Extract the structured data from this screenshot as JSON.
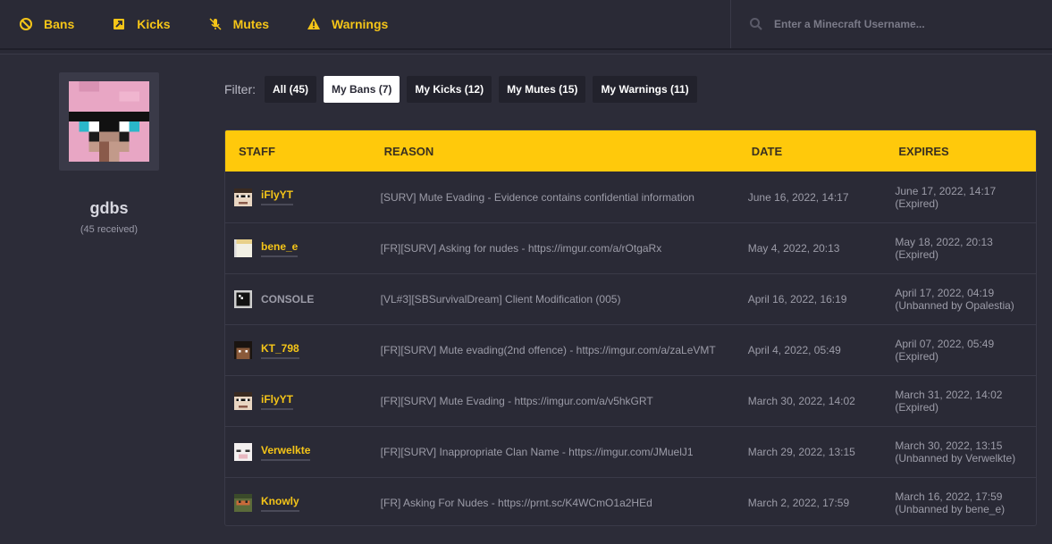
{
  "nav": {
    "bans": "Bans",
    "kicks": "Kicks",
    "mutes": "Mutes",
    "warnings": "Warnings",
    "search_placeholder": "Enter a Minecraft Username..."
  },
  "profile": {
    "username": "gdbs",
    "received": "(45 received)"
  },
  "filters": {
    "label": "Filter:",
    "items": [
      {
        "label": "All (45)",
        "active": false
      },
      {
        "label": "My Bans (7)",
        "active": true
      },
      {
        "label": "My Kicks (12)",
        "active": false
      },
      {
        "label": "My Mutes (15)",
        "active": false
      },
      {
        "label": "My Warnings (11)",
        "active": false
      }
    ]
  },
  "table": {
    "headers": {
      "staff": "STAFF",
      "reason": "REASON",
      "date": "DATE",
      "expires": "EXPIRES"
    },
    "rows": [
      {
        "staff": "iFlyYT",
        "reason": "[SURV] Mute Evading - Evidence contains confidential information",
        "date": "June 16, 2022, 14:17",
        "expires": "June 17, 2022, 14:17",
        "status": "(Expired)"
      },
      {
        "staff": "bene_e",
        "reason": "[FR][SURV] Asking for nudes - https://imgur.com/a/rOtgaRx",
        "date": "May 4, 2022, 20:13",
        "expires": "May 18, 2022, 20:13",
        "status": "(Expired)"
      },
      {
        "staff": "CONSOLE",
        "reason": "[VL#3][SBSurvivalDream] Client Modification (005)",
        "date": "April 16, 2022, 16:19",
        "expires": "April 17, 2022, 04:19",
        "status": "(Unbanned by Opalestia)"
      },
      {
        "staff": "KT_798",
        "reason": "[FR][SURV] Mute evading(2nd offence) - https://imgur.com/a/zaLeVMT",
        "date": "April 4, 2022, 05:49",
        "expires": "April 07, 2022, 05:49",
        "status": "(Expired)"
      },
      {
        "staff": "iFlyYT",
        "reason": "[FR][SURV] Mute Evading - https://imgur.com/a/v5hkGRT",
        "date": "March 30, 2022, 14:02",
        "expires": "March 31, 2022, 14:02",
        "status": "(Expired)"
      },
      {
        "staff": "Verwelkte",
        "reason": "[FR][SURV] Inappropriate Clan Name - https://imgur.com/JMuelJ1",
        "date": "March 29, 2022, 13:15",
        "expires": "March 30, 2022, 13:15",
        "status": "(Unbanned by Verwelkte)"
      },
      {
        "staff": "Knowly",
        "reason": "[FR] Asking For Nudes - https://prnt.sc/K4WCmO1a2HEd",
        "date": "March 2, 2022, 17:59",
        "expires": "March 16, 2022, 17:59",
        "status": "(Unbanned by bene_e)"
      }
    ]
  },
  "colors": {
    "accent": "#f5c518",
    "header": "#ffc90b",
    "background": "#2a2a36"
  }
}
